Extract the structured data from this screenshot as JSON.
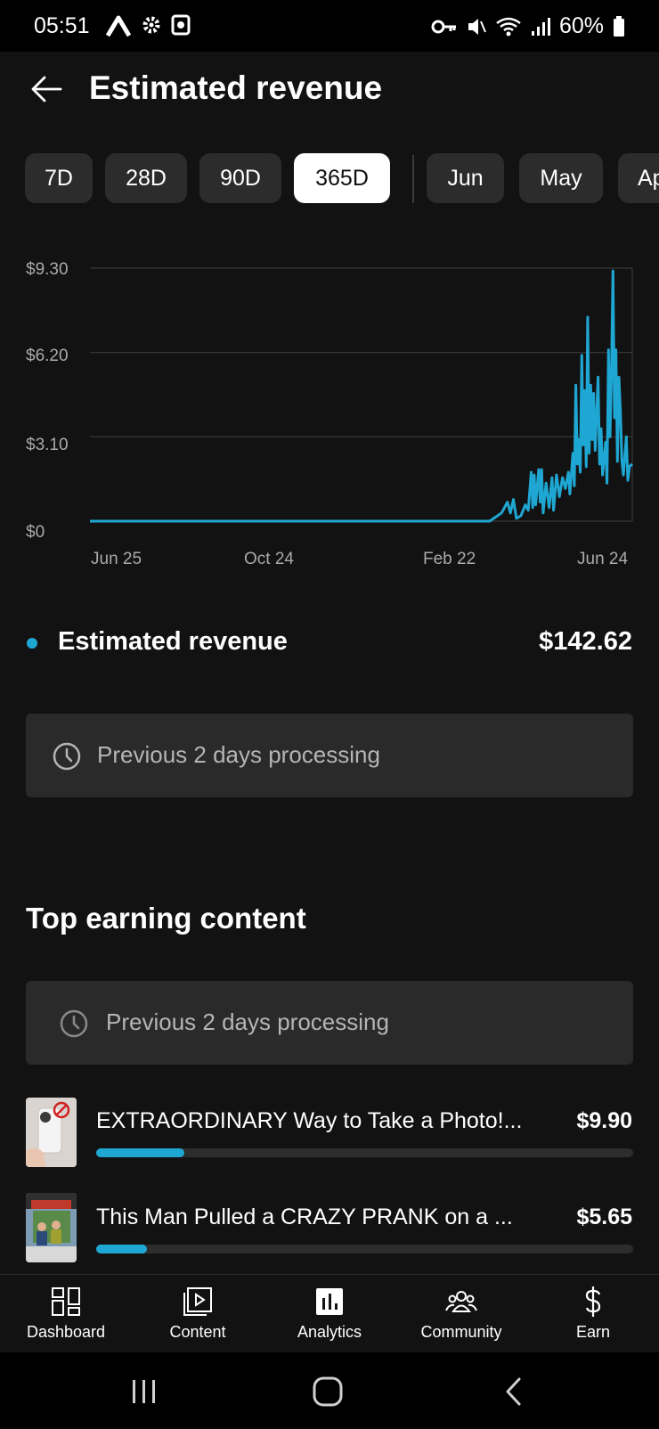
{
  "status_bar": {
    "time": "05:51",
    "battery": "60%"
  },
  "header": {
    "title": "Estimated revenue"
  },
  "range_chips": [
    {
      "label": "7D"
    },
    {
      "label": "28D"
    },
    {
      "label": "90D"
    },
    {
      "label": "365D"
    },
    {
      "label": "Jun"
    },
    {
      "label": "May"
    },
    {
      "label": "Ap"
    }
  ],
  "selected_range": "365D",
  "chart_data": {
    "type": "line",
    "series": [
      {
        "color": "#1fa7d3",
        "points": [
          [
            "2023-06-25",
            0
          ],
          [
            "2024-03-01",
            0
          ],
          [
            "2024-03-20",
            0
          ],
          [
            "2024-03-28",
            0.3
          ],
          [
            "2024-04-01",
            0.7
          ],
          [
            "2024-04-03",
            0.3
          ],
          [
            "2024-04-05",
            0.8
          ],
          [
            "2024-04-07",
            0.1
          ],
          [
            "2024-04-10",
            0.2
          ],
          [
            "2024-04-13",
            0.6
          ],
          [
            "2024-04-15",
            0.4
          ],
          [
            "2024-04-17",
            1.8
          ],
          [
            "2024-04-18",
            0.5
          ],
          [
            "2024-04-19",
            1.7
          ],
          [
            "2024-04-20",
            0.6
          ],
          [
            "2024-04-22",
            1.9
          ],
          [
            "2024-04-23",
            0.7
          ],
          [
            "2024-04-24",
            1.9
          ],
          [
            "2024-04-25",
            0.3
          ],
          [
            "2024-04-27",
            1.4
          ],
          [
            "2024-04-29",
            0.5
          ],
          [
            "2024-05-01",
            1.6
          ],
          [
            "2024-05-02",
            0.4
          ],
          [
            "2024-05-04",
            1.7
          ],
          [
            "2024-05-06",
            0.9
          ],
          [
            "2024-05-08",
            1.6
          ],
          [
            "2024-05-10",
            1.2
          ],
          [
            "2024-05-12",
            1.8
          ],
          [
            "2024-05-13",
            1.0
          ],
          [
            "2024-05-15",
            2.5
          ],
          [
            "2024-05-16",
            1.3
          ],
          [
            "2024-05-17",
            5.0
          ],
          [
            "2024-05-18",
            2.1
          ],
          [
            "2024-05-19",
            3.0
          ],
          [
            "2024-05-20",
            1.8
          ],
          [
            "2024-05-21",
            6.1
          ],
          [
            "2024-05-22",
            2.8
          ],
          [
            "2024-05-23",
            4.8
          ],
          [
            "2024-05-24",
            2.0
          ],
          [
            "2024-05-25",
            7.5
          ],
          [
            "2024-05-26",
            2.5
          ],
          [
            "2024-05-27",
            5.0
          ],
          [
            "2024-05-28",
            3.0
          ],
          [
            "2024-05-29",
            4.7
          ],
          [
            "2024-05-30",
            2.6
          ],
          [
            "2024-06-01",
            5.3
          ],
          [
            "2024-06-02",
            2.1
          ],
          [
            "2024-06-03",
            3.4
          ],
          [
            "2024-06-04",
            1.7
          ],
          [
            "2024-06-06",
            2.9
          ],
          [
            "2024-06-07",
            1.4
          ],
          [
            "2024-06-08",
            6.3
          ],
          [
            "2024-06-09",
            3.1
          ],
          [
            "2024-06-10",
            5.4
          ],
          [
            "2024-06-11",
            9.2
          ],
          [
            "2024-06-12",
            3.8
          ],
          [
            "2024-06-13",
            6.3
          ],
          [
            "2024-06-14",
            2.2
          ],
          [
            "2024-06-15",
            5.3
          ],
          [
            "2024-06-16",
            4.0
          ],
          [
            "2024-06-17",
            2.2
          ],
          [
            "2024-06-18",
            1.7
          ],
          [
            "2024-06-20",
            3.1
          ],
          [
            "2024-06-21",
            1.5
          ],
          [
            "2024-06-22",
            2.0
          ],
          [
            "2024-06-24",
            2.1
          ]
        ]
      }
    ],
    "y_ticks": [
      "$9.30",
      "$6.20",
      "$3.10",
      "$0"
    ],
    "x_ticks": [
      "Jun 25",
      "Oct 24",
      "Feb 22",
      "Jun 24"
    ],
    "ylim": [
      0,
      9.3
    ],
    "grid": true
  },
  "summary": {
    "label": "Estimated revenue",
    "value": "$142.62",
    "color": "#1fa7d3"
  },
  "processing_notice": "Previous 2 days processing",
  "top_content": {
    "title": "Top earning content",
    "processing_notice": "Previous 2 days processing",
    "items": [
      {
        "title": "EXTRAORDINARY Way to Take a Photo!...",
        "value": "$9.90",
        "share": 0.165
      },
      {
        "title": "This Man Pulled a CRAZY PRANK on a ...",
        "value": "$5.65",
        "share": 0.095
      }
    ]
  },
  "bottom_nav": [
    {
      "label": "Dashboard",
      "icon": "dashboard-icon"
    },
    {
      "label": "Content",
      "icon": "content-icon"
    },
    {
      "label": "Analytics",
      "icon": "analytics-icon"
    },
    {
      "label": "Community",
      "icon": "community-icon"
    },
    {
      "label": "Earn",
      "icon": "earn-icon"
    }
  ],
  "selected_nav": "Analytics"
}
